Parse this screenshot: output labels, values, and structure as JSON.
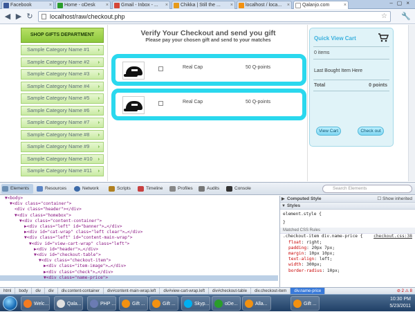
{
  "browser": {
    "tabs": [
      {
        "label": "Facebook",
        "color": "#3b5998"
      },
      {
        "label": "Home - oDesk",
        "color": "#2a9d2a"
      },
      {
        "label": "Gmail - Inbox - ...",
        "color": "#d44638"
      },
      {
        "label": "Chikka | Still the ...",
        "color": "#e69a1a"
      },
      {
        "label": "localhost / loca...",
        "color": "#f29111"
      },
      {
        "label": "Qalanjo.com",
        "color": "#ffffff"
      }
    ],
    "url": "localhost/raw/checkout.php"
  },
  "sidebar": {
    "department_label": "SHOP GIFTS DEPARTMENT",
    "categories": [
      "Sample Category Name #1",
      "Sample Category Name #2",
      "Sample Category Name #3",
      "Sample Category Name #4",
      "Sample Category Name #5",
      "Sample Category Name #6",
      "Sample Category Name #7",
      "Sample Category Name #8",
      "Sample Category Name #9",
      "Sample Category Name #10",
      "Sample Category Name #11"
    ]
  },
  "checkout": {
    "title": "Verify Your Checkout and send you gift",
    "subtitle": "Please pay your chosen gift and send to your matches",
    "items": [
      {
        "name": "Real Cap",
        "price": "50 Q-points"
      },
      {
        "name": "Real Cap",
        "price": "50 Q-points"
      }
    ]
  },
  "cart": {
    "title": "Quick View Cart",
    "items_count": "0 items",
    "last_bought": "Last Bought Item Here",
    "total_label": "Total",
    "total_value": "0 points",
    "view_cart_label": "View Cart",
    "checkout_label": "Check out"
  },
  "devtools": {
    "tabs": [
      "Elements",
      "Resources",
      "Network",
      "Scripts",
      "Timeline",
      "Profiles",
      "Audits",
      "Console"
    ],
    "search_placeholder": "Search Elements",
    "dom_lines": [
      {
        "indent": 1,
        "text": "▼<body>"
      },
      {
        "indent": 2,
        "text": "▼<div class=\"container\">"
      },
      {
        "indent": 3,
        "text": "<div class=\"header\"></div>"
      },
      {
        "indent": 3,
        "text": "▼<div class=\"homebox\">"
      },
      {
        "indent": 4,
        "text": "▼<div class=\"content-container\">"
      },
      {
        "indent": 5,
        "text": "▶<div class=\"left\" id=\"banner\">…</div>"
      },
      {
        "indent": 5,
        "text": "▶<div id=\"cat-wrap\" class=\"left clear\">…</div>"
      },
      {
        "indent": 5,
        "text": "▼<div class=\"left\" id=\"content-main-wrap\">"
      },
      {
        "indent": 6,
        "text": "▼<div id=\"view-cart-wrap\" class=\"left\">"
      },
      {
        "indent": 7,
        "text": "▶<div id=\"header\">…</div>"
      },
      {
        "indent": 7,
        "text": "▼<div id=\"checkout-table\">"
      },
      {
        "indent": 8,
        "text": "▼<div class=\"checkout-item\">"
      },
      {
        "indent": 9,
        "text": "▶<div class=\"item-image\">…</div>"
      },
      {
        "indent": 9,
        "text": "▶<div class=\"check\">…</div>"
      },
      {
        "indent": 9,
        "text": "▼<div class=\"name-price\">"
      }
    ],
    "side": {
      "computed_style": "Computed Style",
      "show_inherited": "Show inherited",
      "styles": "Styles",
      "element_style": "element.style {",
      "element_close": "}",
      "matched_rules": "Matched CSS Rules",
      "selector": ".checkout-item div.name-price {",
      "file": "checkout.css:38",
      "props": [
        {
          "name": "float",
          "value": "right;"
        },
        {
          "name": "padding",
          "value": "20px 7px;"
        },
        {
          "name": "margin",
          "value": "10px 10px;"
        },
        {
          "name": "text-align",
          "value": "left;"
        },
        {
          "name": "width",
          "value": "300px;"
        },
        {
          "name": "border-radius",
          "value": "10px;"
        }
      ]
    },
    "crumbs": [
      "html",
      "body",
      "div",
      "div",
      "div.content-container",
      "div#content-main-wrap.left",
      "div#view-cart-wrap.left",
      "div#checkout-table",
      "div.checkout-item",
      "div.name-price"
    ],
    "status": "⊘ 2 ⚠ 8"
  },
  "taskbar": {
    "items": [
      {
        "label": "Welc...",
        "color": "#f47b20"
      },
      {
        "label": "Qala...",
        "color": "#e0e0e0"
      },
      {
        "label": "PHP ...",
        "color": "#6b7bb3"
      },
      {
        "label": "Gift ...",
        "color": "#f29111"
      },
      {
        "label": "Gift ...",
        "color": "#f29111"
      },
      {
        "label": "Skyp...",
        "color": "#00aff0"
      },
      {
        "label": "oDe...",
        "color": "#2a9d2a"
      },
      {
        "label": "Alla...",
        "color": "#f29111"
      },
      {
        "label": "Gift ...",
        "color": "#f29111"
      }
    ],
    "time": "10:30 PM",
    "date": "5/23/2011"
  }
}
